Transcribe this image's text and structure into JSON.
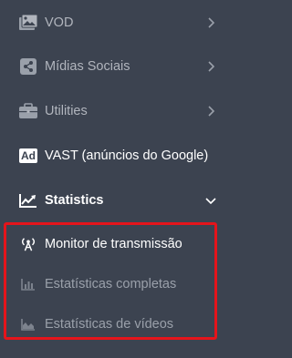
{
  "menu": {
    "vod": {
      "label": "VOD",
      "icon": "video-image-icon"
    },
    "social": {
      "label": "Mídias Sociais",
      "icon": "share-icon"
    },
    "utilities": {
      "label": "Utilities",
      "icon": "briefcase-icon"
    },
    "vast": {
      "label": "VAST (anúncios do Google)",
      "icon": "ad-badge-icon",
      "badge": "Ad"
    },
    "statistics": {
      "label": "Statistics",
      "icon": "line-chart-icon",
      "expanded": true,
      "children": [
        {
          "label": "Monitor de transmissão",
          "icon": "broadcast-icon"
        },
        {
          "label": "Estatísticas completas",
          "icon": "bar-chart-icon"
        },
        {
          "label": "Estatísticas de vídeos",
          "icon": "area-chart-icon"
        }
      ]
    }
  },
  "colors": {
    "background": "#3c4350",
    "text_muted": "#b1b5bd",
    "text_bright": "#ffffff",
    "highlight": "#e5141b"
  }
}
